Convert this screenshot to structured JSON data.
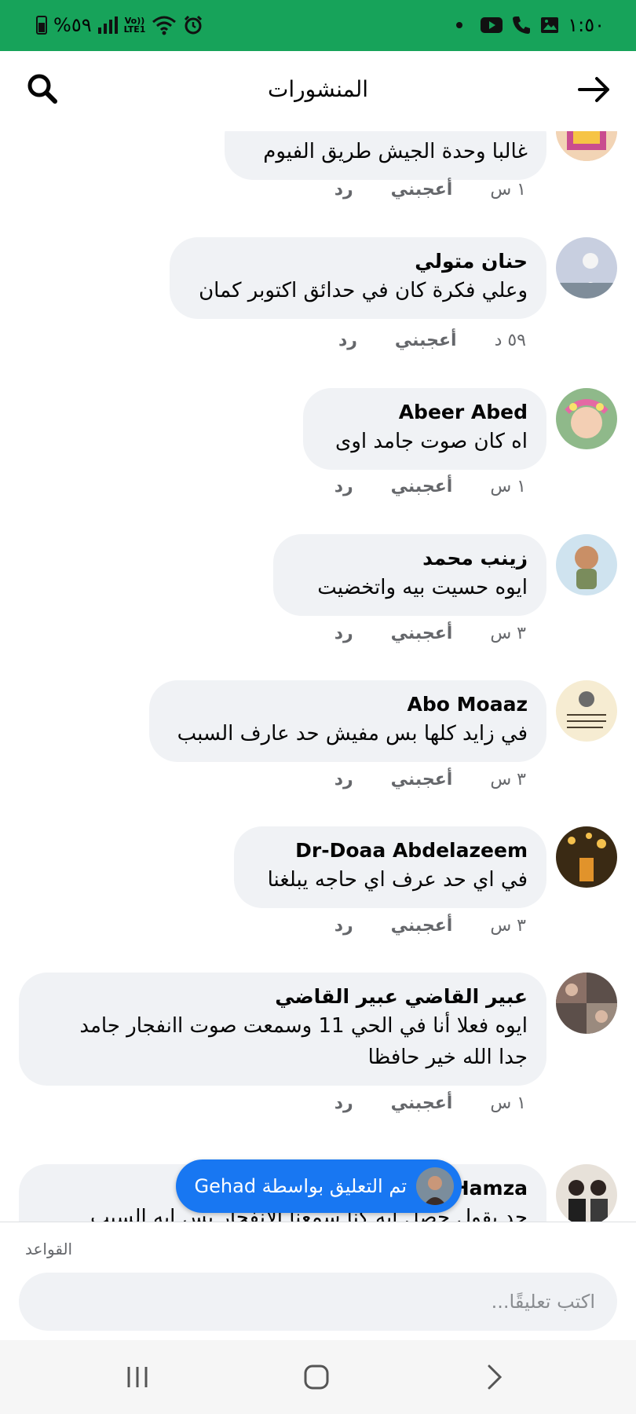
{
  "status_bar": {
    "battery": "%٥٩",
    "network": "LTE1",
    "volte": "Vo))",
    "time": "١:٥٠"
  },
  "header": {
    "title": "المنشورات"
  },
  "comments": [
    {
      "author": "",
      "lines": [
        "غالبا وحدة الجيش طريق الفيوم"
      ],
      "time": "١ س",
      "like": "أعجبني",
      "reply": "رد"
    },
    {
      "author": "حنان متولي",
      "lines": [
        "وعلي فكرة كان في حدائق اكتوبر كمان"
      ],
      "time": "٥٩ د",
      "like": "أعجبني",
      "reply": "رد"
    },
    {
      "author": "Abeer Abed",
      "lines": [
        "اه كان صوت جامد اوى"
      ],
      "time": "١ س",
      "like": "أعجبني",
      "reply": "رد"
    },
    {
      "author": "زينب محمد",
      "lines": [
        "ايوه حسيت بيه واتخضيت"
      ],
      "time": "٣ س",
      "like": "أعجبني",
      "reply": "رد"
    },
    {
      "author": "Abo Moaaz",
      "lines": [
        "في زايد كلها بس مفيش حد عارف السبب"
      ],
      "time": "٣ س",
      "like": "أعجبني",
      "reply": "رد"
    },
    {
      "author": "Dr-Doaa Abdelazeem",
      "lines": [
        "في اي حد عرف اي حاجه يبلغنا"
      ],
      "time": "٣ س",
      "like": "أعجبني",
      "reply": "رد"
    },
    {
      "author": "عبير القاضي عبير القاضي",
      "lines": [
        "ايوه فعلا أنا في الحي 11  وسمعت صوت اانفجار جامد",
        "جدا  الله خير حافظا"
      ],
      "time": "١ س",
      "like": "أعجبني",
      "reply": "رد"
    },
    {
      "author": "Hamza",
      "lines": [
        "حد يقول حصل ايه كنا سمعنا الانفجار بس ايه السبب"
      ],
      "time": "",
      "like": "",
      "reply": ""
    }
  ],
  "toast": {
    "text": "تم التعليق بواسطة Gehad"
  },
  "composer": {
    "rules": "القواعد",
    "placeholder": "اكتب تعليقًا..."
  },
  "icons": {
    "back": "arrow-right-icon",
    "search": "search-icon"
  },
  "colors": {
    "status_bar": "#17a35a",
    "bubble": "#f0f2f5",
    "toast": "#1877f2"
  }
}
